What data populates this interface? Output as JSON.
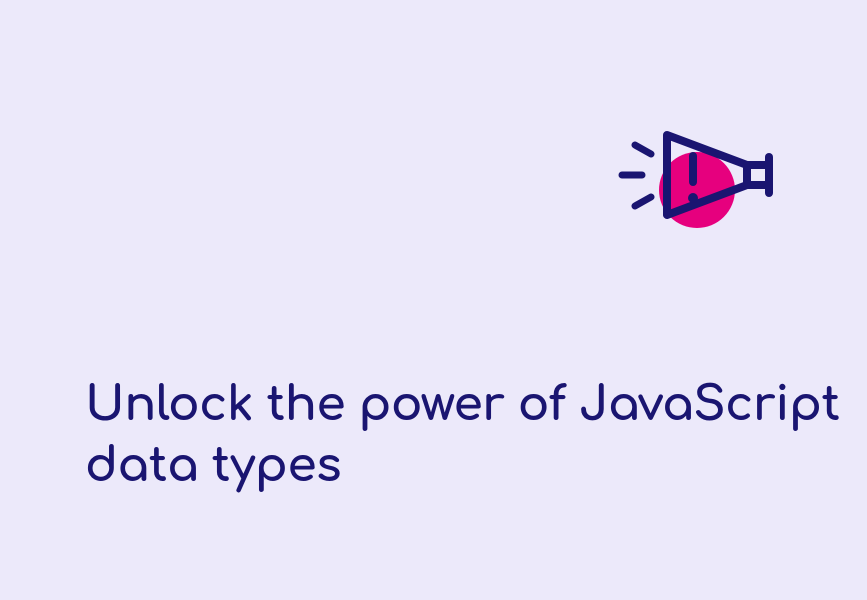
{
  "headline": "Unlock the power of JavaScript data types",
  "colors": {
    "background": "#ece9fa",
    "text": "#1a1571",
    "accent": "#e6007e",
    "icon_stroke": "#1a1571"
  },
  "icon": {
    "name": "megaphone-icon"
  }
}
